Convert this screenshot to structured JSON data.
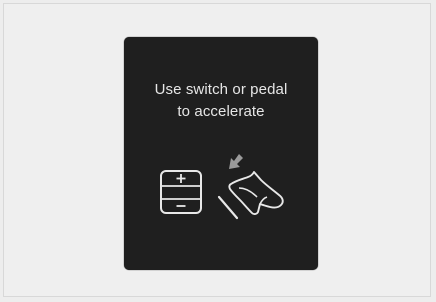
{
  "display": {
    "message_line1": "Use switch or pedal",
    "message_line2": "to accelerate"
  },
  "icons": {
    "switch": "accelerate-switch-icon",
    "pedal": "foot-pedal-icon"
  },
  "colors": {
    "background": "#ededed",
    "panel": "#1f1f1f",
    "text": "#e6e6e6"
  }
}
